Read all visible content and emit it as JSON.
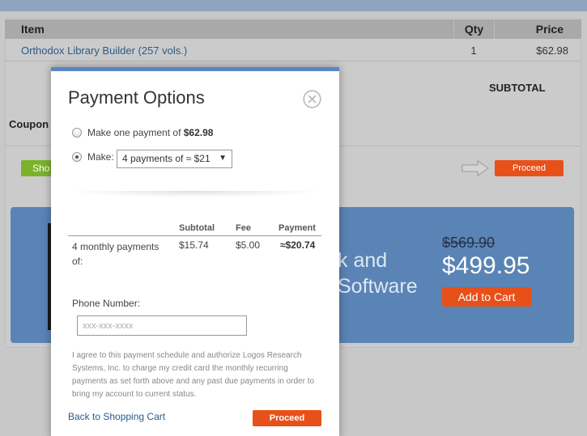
{
  "cart": {
    "headers": {
      "item": "Item",
      "qty": "Qty",
      "price": "Price"
    },
    "rows": [
      {
        "item": "Orthodox Library Builder (257 vols.)",
        "qty": "1",
        "price": "$62.98"
      }
    ],
    "subtotal_label": "SUBTOTAL",
    "coupon_label": "Coupon",
    "shopping_button_label": "Sho",
    "proceed_label": "Proceed"
  },
  "promo": {
    "text_line1": "k and",
    "text_line2": "Software",
    "old_price": "$569.90",
    "new_price": "$499.95",
    "add_to_cart_label": "Add to Cart"
  },
  "modal": {
    "title": "Payment Options",
    "option_one_prefix": "Make one payment of ",
    "option_one_amount": "$62.98",
    "option_two_prefix": "Make:",
    "selected_plan": "4 payments of ≈ $21",
    "table": {
      "headers": {
        "subtotal": "Subtotal",
        "fee": "Fee",
        "payment": "Payment"
      },
      "row": {
        "description": "4 monthly payments of:",
        "subtotal": "$15.74",
        "fee": "$5.00",
        "payment": "≈$20.74"
      }
    },
    "phone_label": "Phone Number:",
    "phone_placeholder": "xxx-xxx-xxxx",
    "agreement": "I agree to this payment schedule and authorize Logos Research Systems, Inc. to charge my credit card the monthly recurring payments as set forth above and any past due payments in order to bring my account to current status.",
    "back_link": "Back to Shopping Cart",
    "proceed_label": "Proceed"
  },
  "colors": {
    "accent_orange": "#e8501a",
    "modal_top_border": "#5a87c1",
    "link_blue": "#2c5a86",
    "promo_blue": "#5a84b5",
    "shop_green": "#7ab22c"
  }
}
